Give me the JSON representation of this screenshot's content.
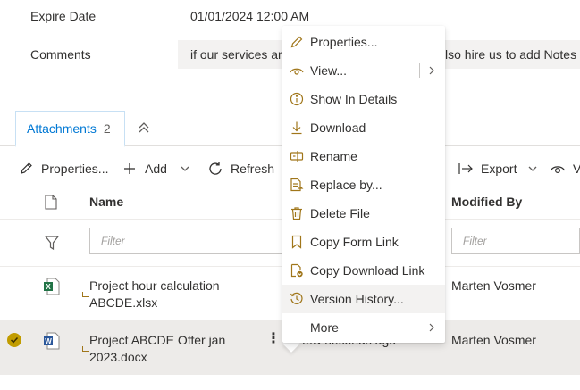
{
  "form": {
    "expire_label": "Expire Date",
    "expire_value": "01/01/2024 12:00 AM",
    "comments_label": "Comments",
    "comments_value_left": "if our services are",
    "comments_value_right": "lso hire us to add Notes a"
  },
  "tabs": {
    "attachments_label": "Attachments",
    "attachments_count": "2"
  },
  "toolbar": {
    "properties_label": "Properties...",
    "add_label": "Add",
    "refresh_label": "Refresh",
    "export_label": "Export",
    "view_label": "V"
  },
  "grid": {
    "columns": {
      "name": "Name",
      "modified_by": "Modified By"
    },
    "filter_placeholder": "Filter",
    "rows": [
      {
        "name_line1": "Project hour calculation",
        "name_line2": "ABCDE.xlsx",
        "modified_by": "Marten Vosmer",
        "file_type": "excel"
      },
      {
        "name_line1": "Project ABCDE Offer jan",
        "name_line2": "2023.docx",
        "modified_by": "Marten Vosmer",
        "modified_partial": "few seconds ago",
        "file_type": "word",
        "selected": true
      }
    ]
  },
  "context_menu": {
    "items": [
      {
        "label": "Properties...",
        "icon": "pencil-icon"
      },
      {
        "label": "View...",
        "icon": "eye-icon",
        "submenu": true
      },
      {
        "label": "Show In Details",
        "icon": "info-icon"
      },
      {
        "label": "Download",
        "icon": "download-icon"
      },
      {
        "label": "Rename",
        "icon": "rename-icon"
      },
      {
        "label": "Replace by...",
        "icon": "replace-icon"
      },
      {
        "label": "Delete File",
        "icon": "trash-icon"
      },
      {
        "label": "Copy Form Link",
        "icon": "bookmark-icon"
      },
      {
        "label": "Copy Download Link",
        "icon": "link-download-icon"
      },
      {
        "label": "Version History...",
        "icon": "history-icon",
        "hovered": true
      },
      {
        "label": "More",
        "icon": "",
        "submenu": true
      }
    ]
  },
  "colors": {
    "accent": "#0078d4",
    "selected_row": "#edebe9",
    "check": "#c19c00",
    "excel": "#217346",
    "word": "#2b579a",
    "icon_gold": "#a0761a"
  }
}
